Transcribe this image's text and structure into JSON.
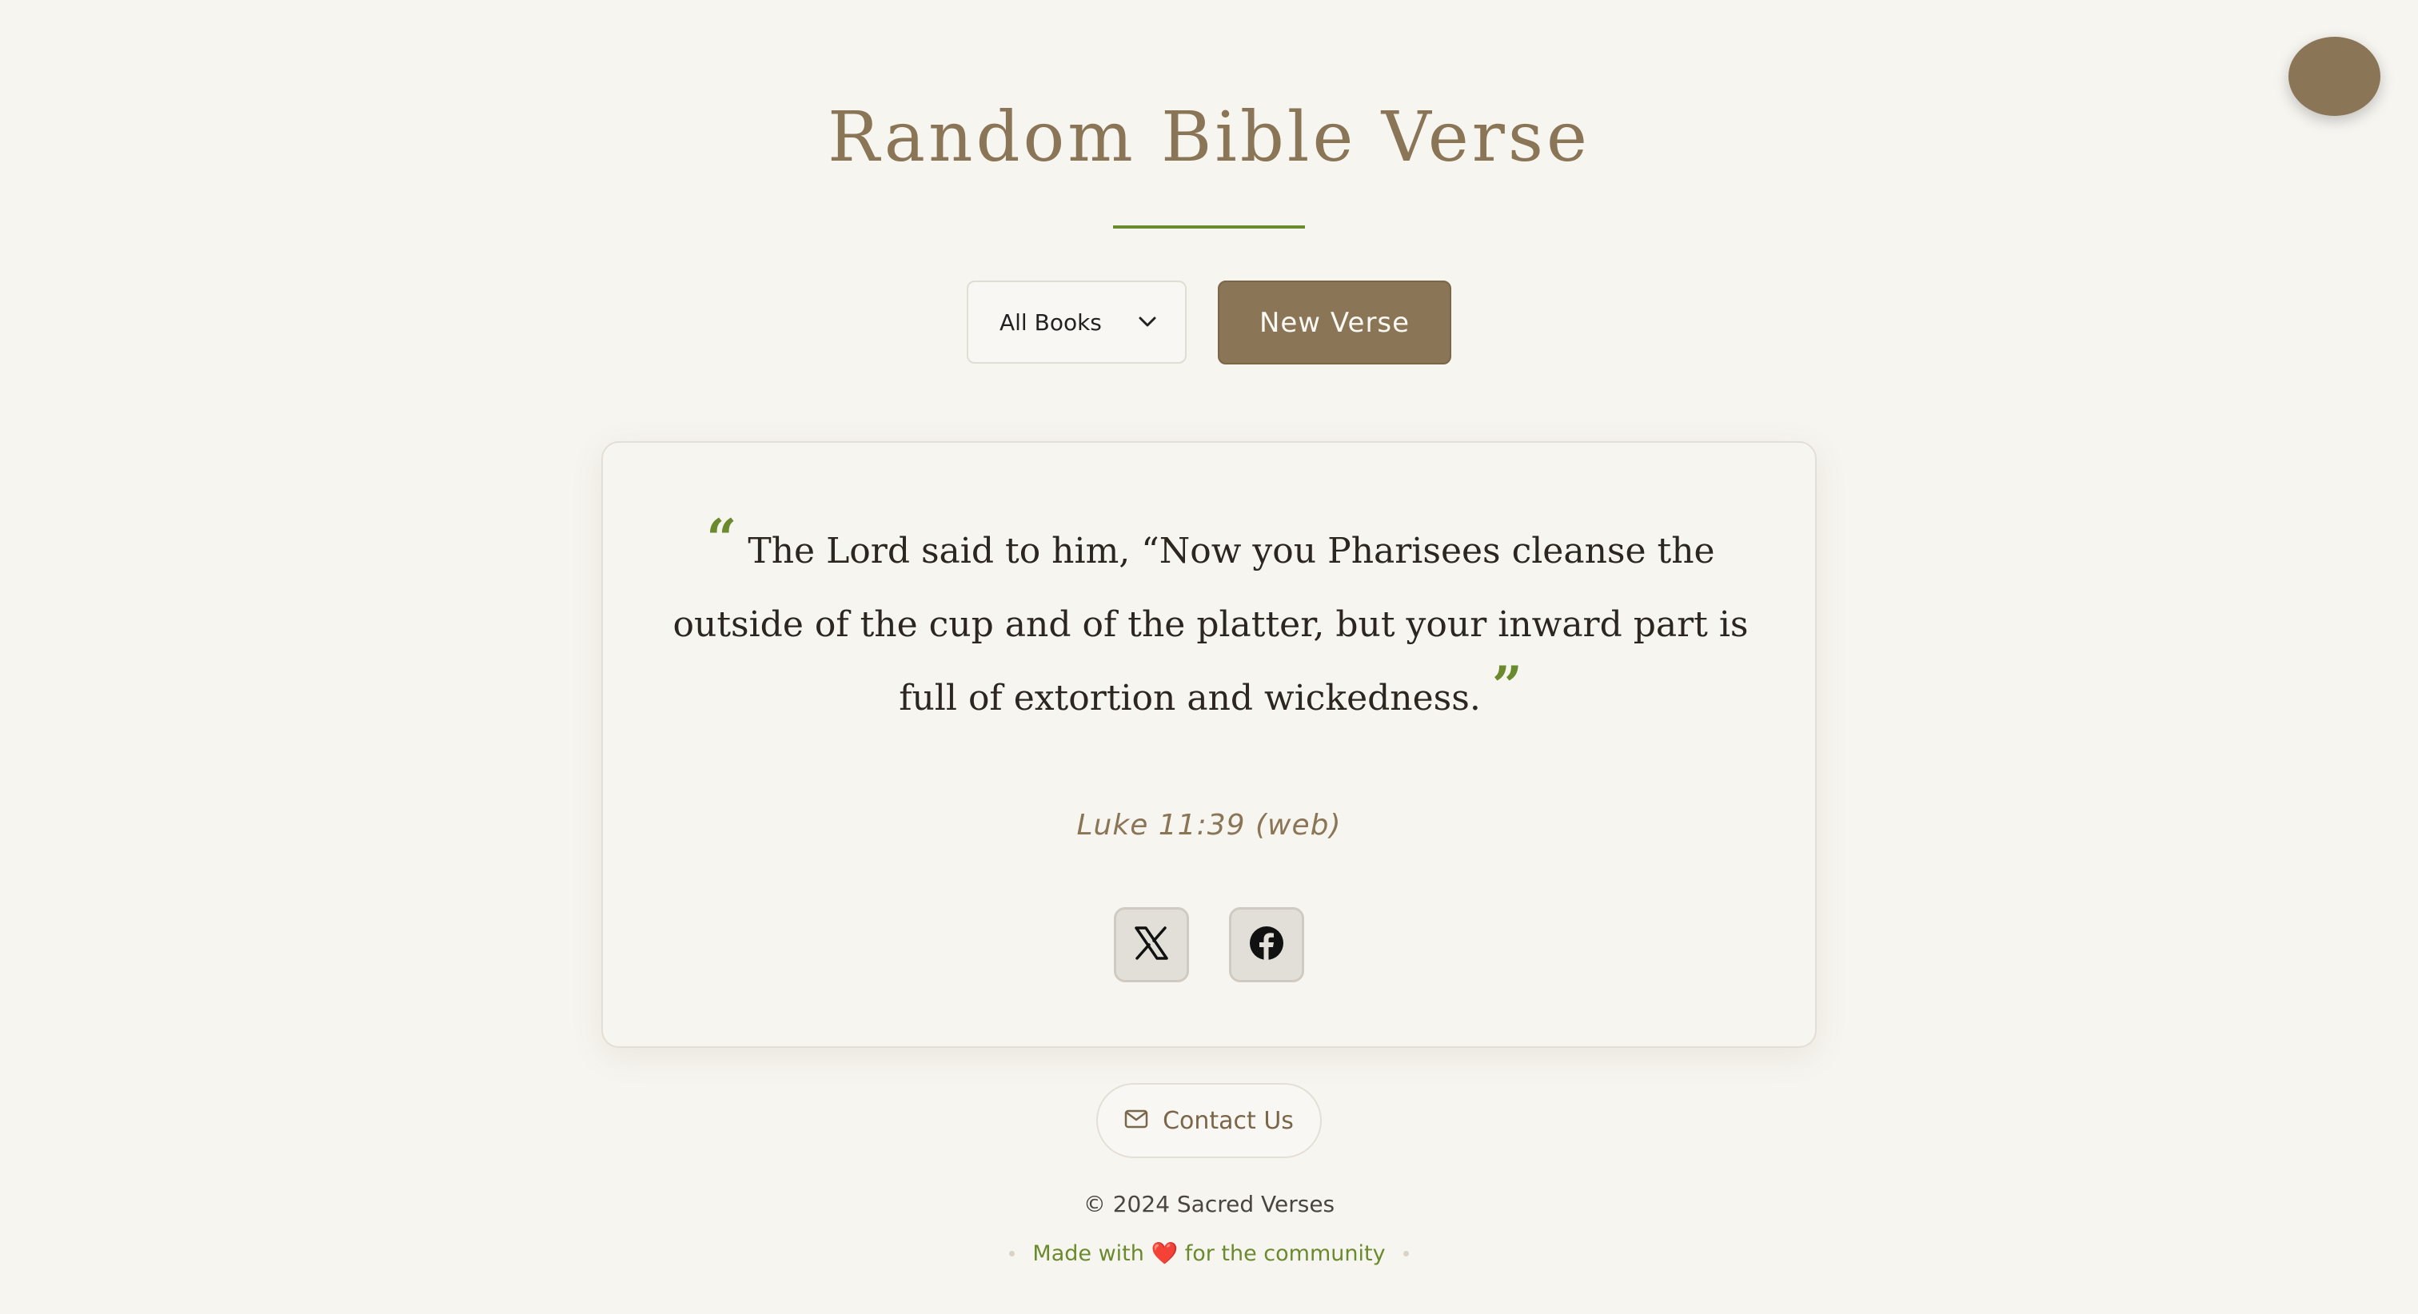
{
  "header": {
    "title": "Random Bible Verse"
  },
  "controls": {
    "book_select_value": "All Books",
    "new_verse_label": "New Verse"
  },
  "verse": {
    "text": "The Lord said to him, “Now you Pharisees cleanse the outside of the cup and of the platter, but your inward part is full of extortion and wickedness.",
    "open_quote": "“",
    "close_quote": "”",
    "reference": "Luke 11:39 (web)"
  },
  "share": {
    "x_icon": "x-logo-icon",
    "facebook_icon": "facebook-icon"
  },
  "footer": {
    "contact_label": "Contact Us",
    "copyright": "© 2024 Sacred Verses",
    "tagline_before": "Made with",
    "tagline_heart": "❤️",
    "tagline_after": "for the community"
  },
  "colors": {
    "background": "#f7f5f0",
    "accent_brown": "#8a7556",
    "accent_green": "#6b8a2e",
    "text_dark": "#2b2620"
  }
}
